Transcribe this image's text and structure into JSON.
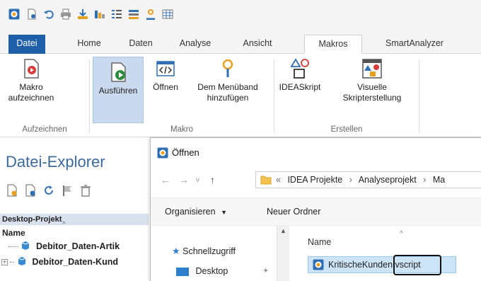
{
  "quick_access": {
    "icons": [
      "idea-logo-icon",
      "new-project-icon",
      "undo-icon",
      "print-icon",
      "import-icon",
      "field-stats-icon",
      "sort-icon",
      "index-icon",
      "user-icon",
      "grid-icon"
    ]
  },
  "tabs": [
    {
      "label": "Datei"
    },
    {
      "label": "Home"
    },
    {
      "label": "Daten"
    },
    {
      "label": "Analyse"
    },
    {
      "label": "Ansicht"
    },
    {
      "label": "Makros"
    },
    {
      "label": "SmartAnalyzer"
    }
  ],
  "ribbon": {
    "record": {
      "line1": "Makro",
      "line2": "aufzeichnen"
    },
    "run": {
      "label": "Ausführen"
    },
    "open": {
      "label": "Öffnen"
    },
    "add_to_ribbon": {
      "line1": "Dem Menüband",
      "line2": "hinzufügen"
    },
    "ideascript": {
      "label": "IDEASkript"
    },
    "visual": {
      "line1": "Visuelle",
      "line2": "Skripterstellung"
    },
    "groups": {
      "record": "Aufzeichnen",
      "macro": "Makro",
      "create": "Erstellen"
    }
  },
  "explorer": {
    "title": "Datei-Explorer",
    "project": "Desktop-Projekt",
    "column": "Name",
    "items": [
      "Debitor_Daten-Artik",
      "Debitor_Daten-Kund"
    ]
  },
  "dialog": {
    "title": "Öffnen",
    "address": {
      "prefix": "«",
      "parts": [
        "IDEA Projekte",
        "Analyseprojekt",
        "Ma"
      ],
      "sep": "›"
    },
    "toolbar": {
      "organize": "Organisieren",
      "new_folder": "Neuer Ordner"
    },
    "nav": {
      "quick_access": "Schnellzugriff",
      "desktop": "Desktop"
    },
    "column_name": "Name",
    "file": {
      "name": "KritischeKunden",
      "ext": ".vscript"
    }
  },
  "colors": {
    "file_tab": "#1f5fa8",
    "accent": "#3d6a9c",
    "selection": "#c9d9ee",
    "file_selection": "#cde4f7"
  }
}
